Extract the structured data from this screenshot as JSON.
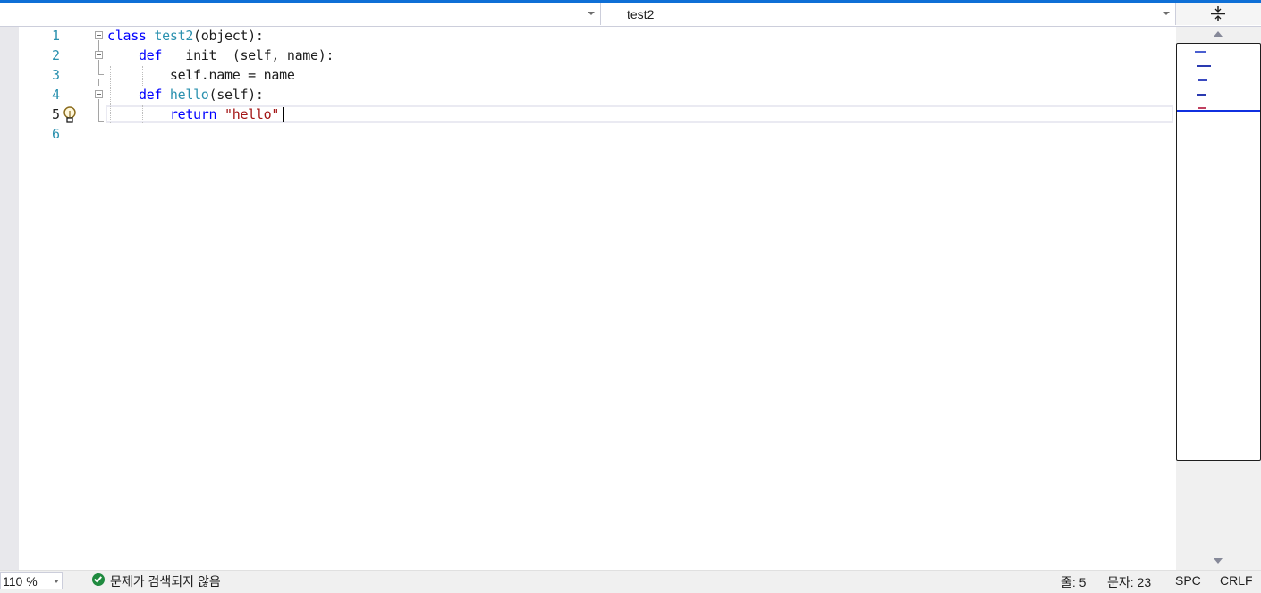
{
  "navbar": {
    "left_combo_value": "",
    "right_combo_value": "test2"
  },
  "editor": {
    "lines": [
      {
        "number": "1"
      },
      {
        "number": "2"
      },
      {
        "number": "3"
      },
      {
        "number": "4"
      },
      {
        "number": "5"
      },
      {
        "number": "6"
      }
    ],
    "code": {
      "l1_kw": "class",
      "l1_name": "test2",
      "l1_rest": "(object):",
      "l2_kw": "def",
      "l2_rest": "__init__(self, name):",
      "l3_text": "self.name = name",
      "l4_kw": "def",
      "l4_name": "hello",
      "l4_rest": "(self):",
      "l5_kw": "return",
      "l5_str": "\"hello\""
    },
    "colors": {
      "keyword": "#0000ff",
      "identifier": "#2b91af",
      "string": "#a31515",
      "active_line_border": "#eaeaf2"
    }
  },
  "icons": {
    "split": "split-editor-icon",
    "lightbulb": "lightbulb-icon",
    "status_ok": "check-circle-icon"
  },
  "status": {
    "zoom": "110 %",
    "issues": "문제가 검색되지 않음",
    "line": "줄: 5",
    "char": "문자: 23",
    "spc": "SPC",
    "eol": "CRLF"
  }
}
